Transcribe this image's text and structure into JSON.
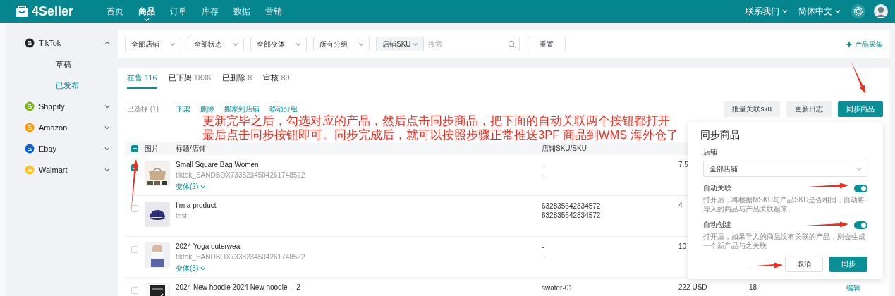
{
  "header": {
    "logo": "4Seller",
    "nav": [
      {
        "label": "首页",
        "selected": false
      },
      {
        "label": "商品",
        "selected": true
      },
      {
        "label": "订单",
        "selected": false
      },
      {
        "label": "库存",
        "selected": false
      },
      {
        "label": "数据",
        "selected": false
      },
      {
        "label": "营销",
        "selected": false
      }
    ],
    "contact": "联系我们",
    "language": "简体中文"
  },
  "sidebar": {
    "platforms": [
      {
        "name": "TikTok",
        "color": "#222222",
        "expanded": true,
        "children": [
          {
            "label": "草稿",
            "selected": false
          },
          {
            "label": "已发布",
            "selected": true
          }
        ]
      },
      {
        "name": "Shopify",
        "color": "#7ab51d",
        "expanded": false
      },
      {
        "name": "Amazon",
        "color": "#ff9900",
        "expanded": false
      },
      {
        "name": "Ebay",
        "color": "#0b63d6",
        "expanded": false
      },
      {
        "name": "Walmart",
        "color": "#ffc220",
        "expanded": false
      }
    ]
  },
  "filters": {
    "selects": [
      "全部店铺",
      "全部状态",
      "全部变体",
      "所有分组"
    ],
    "sku_select": "店铺SKU",
    "search": {
      "placeholder": "搜索"
    },
    "reset": "重置",
    "collect": "产品采集"
  },
  "tabs": [
    {
      "label": "在售",
      "count": "116",
      "selected": true
    },
    {
      "label": "已下架",
      "count": "1836",
      "selected": false
    },
    {
      "label": "已删除",
      "count": "8",
      "selected": false
    },
    {
      "label": "审核",
      "count": "89",
      "selected": false
    }
  ],
  "actions": {
    "selected_count": "已选择 (1)",
    "links": [
      "下架",
      "删除",
      "搬家到店铺",
      "移动分组"
    ],
    "buttons": [
      {
        "label": "批量关联sku",
        "kind": "secondary"
      },
      {
        "label": "更新日志",
        "kind": "secondary"
      },
      {
        "label": "同步商品",
        "kind": "primary"
      }
    ]
  },
  "table": {
    "select_all_partial": true,
    "columns": [
      "图片",
      "标题/店铺",
      "店铺SKU/SKU"
    ],
    "rows": [
      {
        "checked": true,
        "title": "Small Square Bag Women",
        "store": "tiktok_SANDBOX7338234504261748522",
        "variants": "变体(2)",
        "sku": [
          "-",
          "-"
        ],
        "price": "7.5"
      },
      {
        "checked": false,
        "title": "I'm a product",
        "store": "test",
        "sku": [
          "632835642834572",
          "632835642834572"
        ],
        "price": "4"
      },
      {
        "checked": false,
        "title": "2024 Yoga outerwear",
        "store": "tiktok_SANDBOX7338234504261748522",
        "variants": "变体(3)",
        "sku": [
          "-",
          "-"
        ],
        "price": "10"
      },
      {
        "checked": false,
        "title": "2024 New hoodie 2024 New hoodie ---2",
        "sku": [
          "swater-01"
        ],
        "price": "222 USD",
        "stock": "18",
        "action": "编辑"
      }
    ]
  },
  "sync_dialog": {
    "title": "同步商品",
    "store_label": "店铺",
    "store_value": "全部店铺",
    "options": [
      {
        "label": "自动关联",
        "on": true,
        "description": "打开后，将根据MSKU与产品SKU是否相同，自动将导入的商品与产品关联起来。"
      },
      {
        "label": "自动创建",
        "on": true,
        "description": "打开后，如果导入的商品没有关联的产品，则会生成一个新产品与之关联"
      }
    ],
    "cancel": "取消",
    "confirm": "同步"
  },
  "annotation": {
    "lines": [
      "更新完毕之后，勾选对应的产品，然后点击同步商品，把下面的自动关联两个按钮都打开",
      "最后点击同步按钮即可。同步完成后，就可以按照步骤正常推送3PF 商品到WMS 海外仓了"
    ]
  }
}
